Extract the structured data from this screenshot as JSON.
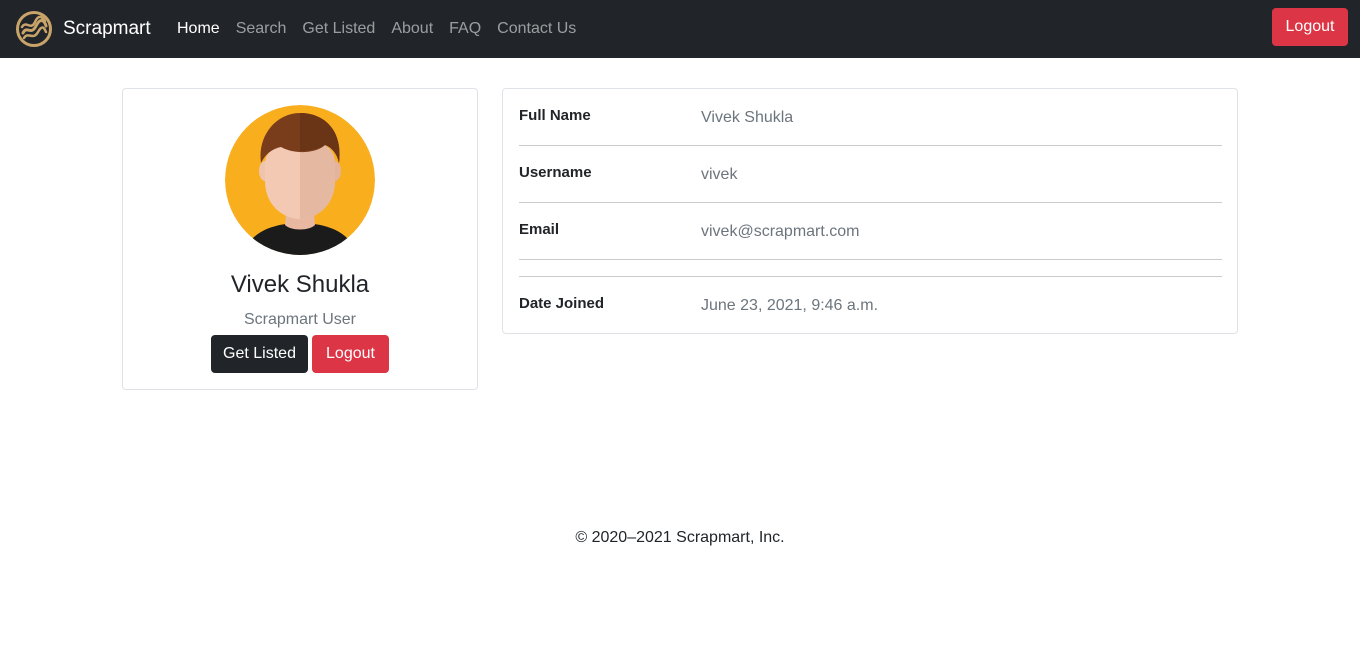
{
  "nav": {
    "brand": "Scrapmart",
    "links": [
      {
        "label": "Home"
      },
      {
        "label": "Search"
      },
      {
        "label": "Get Listed"
      },
      {
        "label": "About"
      },
      {
        "label": "FAQ"
      },
      {
        "label": "Contact Us"
      }
    ],
    "logout_label": "Logout"
  },
  "profile": {
    "name": "Vivek Shukla",
    "role": "Scrapmart User",
    "get_listed_label": "Get Listed",
    "logout_label": "Logout"
  },
  "details": {
    "full_name_label": "Full Name",
    "full_name": "Vivek Shukla",
    "username_label": "Username",
    "username": "vivek",
    "email_label": "Email",
    "email": "vivek@scrapmart.com",
    "date_joined_label": "Date Joined",
    "date_joined": "June 23, 2021, 9:46 a.m."
  },
  "footer": {
    "copyright": "© 2020–2021 Scrapmart, Inc."
  },
  "colors": {
    "navbar_bg": "#212529",
    "danger": "#dc3545",
    "dark": "#212529",
    "avatar_bg": "#f9ae1e",
    "muted_text": "#6c757d"
  }
}
